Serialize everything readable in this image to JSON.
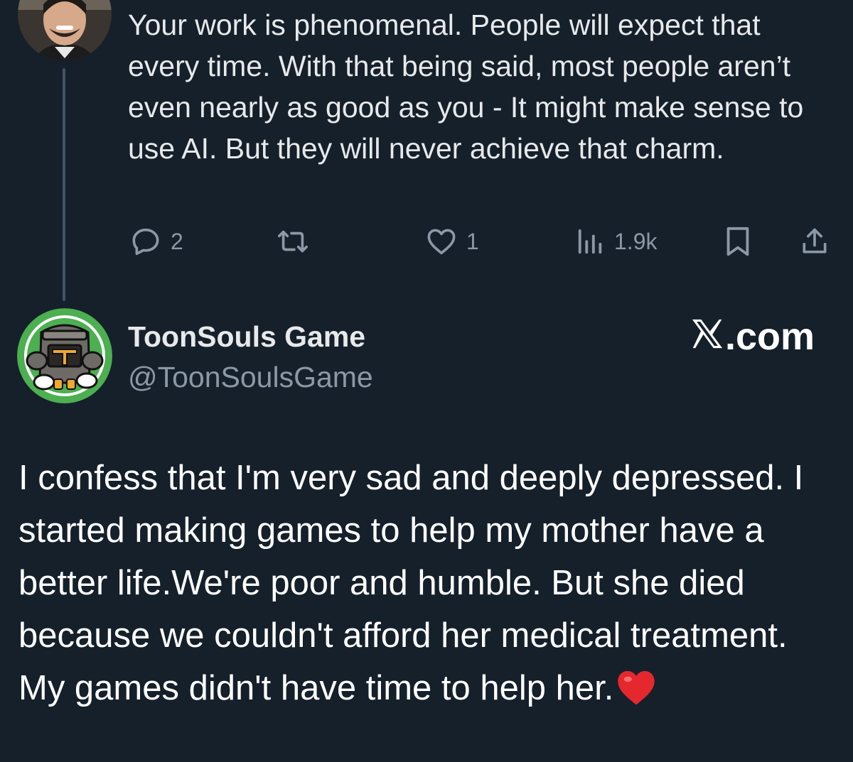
{
  "reply": {
    "text": "Your work is phenomenal. People will expect that every time. With that being said, most people aren’t even nearly as good as you - It might make sense to use AI. But they will never achieve that charm.",
    "actions": {
      "reply_count": "2",
      "like_count": "1",
      "view_count": "1.9k"
    },
    "icons": [
      "reply-icon",
      "retweet-icon",
      "like-icon",
      "views-icon",
      "bookmark-icon",
      "share-icon"
    ]
  },
  "quoted_post": {
    "display_name": "ToonSouls Game",
    "handle": "@ToonSoulsGame",
    "brand": ".com",
    "text": "I confess that I'm very sad and deeply depressed. I started making games to help my mother have a better life.We're poor and humble. But she died because we couldn't afford her medical treatment. My games didn't have time to help her.",
    "emoji": "heart-emoji"
  },
  "colors": {
    "background": "#15202b",
    "text": "#e7e9ea",
    "muted": "#8b98a5",
    "avatar_ring": "#4caf50",
    "heart": "#e5282e"
  }
}
